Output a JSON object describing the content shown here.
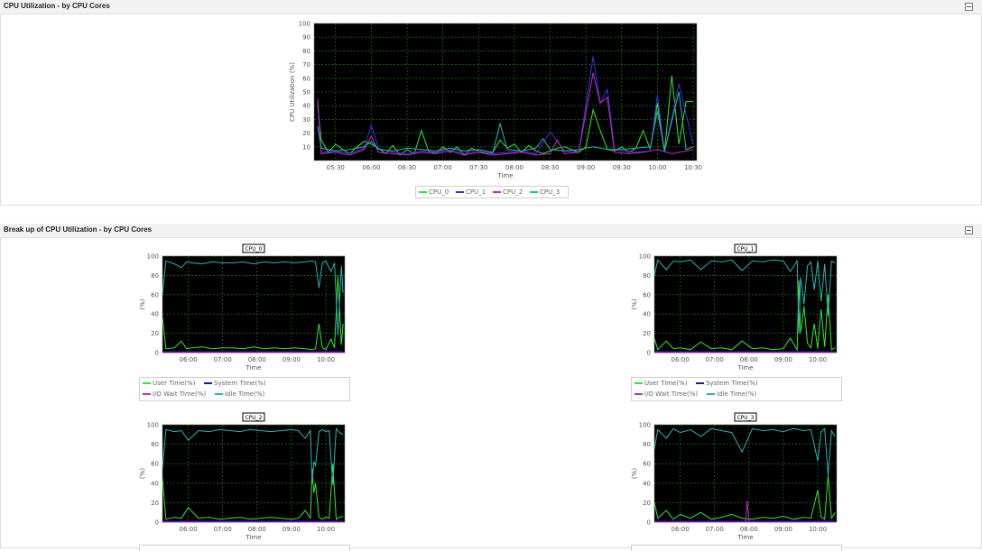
{
  "panels": {
    "top": {
      "title": "CPU Utilization - by CPU Cores"
    },
    "bottom": {
      "title": "Break up of CPU Utilization - by CPU Cores"
    }
  },
  "colors": {
    "CPU_0": "#33e633",
    "CPU_1": "#3b2fd8",
    "CPU_2": "#c02cc0",
    "CPU_3": "#2ab5b5",
    "User Time(%)": "#33e633",
    "System Time(%)": "#1a1aa0",
    "I/O Wait Time(%)": "#c02cc0",
    "Idle Time(%)": "#2ab5b5",
    "plot_bg": "#000000",
    "grid": "#1f8a1f"
  },
  "chart_data": [
    {
      "type": "line",
      "xlabel": "Time",
      "ylabel": "CPU Utilization (%)",
      "ylim": [
        0,
        100
      ],
      "yticks": [
        "100",
        "90",
        "80",
        "70",
        "60",
        "50",
        "40",
        "30",
        "20",
        "10"
      ],
      "xticks": [
        "05:30",
        "06:00",
        "06:30",
        "07:00",
        "07:30",
        "08:00",
        "08:30",
        "09:00",
        "09:30",
        "10:00",
        "10:30"
      ],
      "xrange_hours": [
        5.2,
        10.55
      ],
      "grid": true,
      "legend_position": "bottom",
      "series": [
        {
          "name": "CPU_0",
          "color": "#33e633",
          "x": [
            5.25,
            5.3,
            5.4,
            5.5,
            5.6,
            5.7,
            5.8,
            5.9,
            6.0,
            6.1,
            6.2,
            6.3,
            6.4,
            6.5,
            6.6,
            6.7,
            6.8,
            6.9,
            7.0,
            7.1,
            7.2,
            7.3,
            7.4,
            7.5,
            7.6,
            7.7,
            7.8,
            7.9,
            8.0,
            8.1,
            8.2,
            8.3,
            8.4,
            8.5,
            8.6,
            8.7,
            8.8,
            8.9,
            9.0,
            9.1,
            9.2,
            9.3,
            9.4,
            9.5,
            9.6,
            9.7,
            9.8,
            9.9,
            10.0,
            10.1,
            10.2,
            10.3,
            10.4,
            10.5
          ],
          "values": [
            40,
            15,
            6,
            12,
            8,
            5,
            10,
            14,
            12,
            9,
            5,
            11,
            4,
            8,
            5,
            22,
            7,
            5,
            10,
            6,
            10,
            4,
            9,
            7,
            5,
            6,
            15,
            9,
            12,
            6,
            11,
            7,
            5,
            7,
            9,
            10,
            8,
            6,
            10,
            37,
            22,
            8,
            7,
            10,
            6,
            9,
            22,
            8,
            42,
            6,
            62,
            12,
            43,
            43
          ]
        },
        {
          "name": "CPU_1",
          "color": "#3b2fd8",
          "x": [
            5.25,
            5.3,
            5.5,
            5.7,
            5.9,
            6.0,
            6.1,
            6.3,
            6.5,
            6.7,
            6.9,
            7.1,
            7.3,
            7.5,
            7.7,
            7.9,
            8.1,
            8.3,
            8.5,
            8.7,
            8.9,
            9.1,
            9.2,
            9.3,
            9.4,
            9.5,
            9.7,
            9.9,
            10.0,
            10.1,
            10.3,
            10.5
          ],
          "values": [
            44,
            6,
            7,
            5,
            9,
            26,
            9,
            6,
            5,
            7,
            6,
            8,
            5,
            7,
            5,
            6,
            7,
            5,
            21,
            7,
            6,
            76,
            42,
            52,
            8,
            7,
            6,
            7,
            48,
            6,
            56,
            12
          ]
        },
        {
          "name": "CPU_2",
          "color": "#c02cc0",
          "x": [
            5.25,
            5.3,
            5.5,
            5.7,
            5.9,
            6.0,
            6.1,
            6.3,
            6.5,
            6.7,
            6.9,
            7.1,
            7.3,
            7.5,
            7.7,
            7.9,
            8.1,
            8.3,
            8.5,
            8.6,
            8.7,
            8.9,
            9.1,
            9.2,
            9.3,
            9.4,
            9.6,
            9.8,
            10.0,
            10.2,
            10.4,
            10.5
          ],
          "values": [
            45,
            5,
            6,
            4,
            8,
            18,
            6,
            5,
            4,
            6,
            5,
            7,
            4,
            6,
            4,
            5,
            6,
            4,
            5,
            15,
            5,
            6,
            64,
            42,
            46,
            6,
            5,
            6,
            8,
            5,
            7,
            8
          ]
        },
        {
          "name": "CPU_3",
          "color": "#2ab5b5",
          "x": [
            5.25,
            5.3,
            5.5,
            5.7,
            5.9,
            6.0,
            6.1,
            6.3,
            6.5,
            6.7,
            6.9,
            7.1,
            7.3,
            7.5,
            7.7,
            7.8,
            7.9,
            8.1,
            8.3,
            8.4,
            8.5,
            8.7,
            8.9,
            9.1,
            9.3,
            9.5,
            9.7,
            9.9,
            10.0,
            10.1,
            10.3,
            10.4,
            10.5
          ],
          "values": [
            25,
            9,
            7,
            8,
            10,
            14,
            8,
            7,
            9,
            8,
            7,
            9,
            7,
            8,
            6,
            27,
            8,
            7,
            9,
            16,
            8,
            7,
            8,
            10,
            8,
            8,
            9,
            10,
            36,
            7,
            50,
            8,
            10
          ]
        }
      ]
    },
    {
      "type": "line",
      "title": "CPU_0",
      "xlabel": "Time",
      "ylabel": "(%)",
      "ylim": [
        0,
        100
      ],
      "yticks": [
        "100",
        "80",
        "60",
        "40",
        "20",
        "0"
      ],
      "xticks": [
        "06:00",
        "07:00",
        "08:00",
        "09:00",
        "10:00"
      ],
      "xrange_hours": [
        5.25,
        10.55
      ],
      "legend_position": "bottom",
      "series": [
        {
          "name": "User Time(%)",
          "color": "#33e633",
          "x": [
            5.25,
            5.35,
            5.6,
            5.8,
            5.95,
            6.1,
            6.4,
            6.7,
            7.0,
            7.3,
            7.6,
            7.9,
            8.2,
            8.5,
            8.8,
            9.1,
            9.4,
            9.6,
            9.7,
            9.8,
            9.9,
            10.0,
            10.15,
            10.25,
            10.35,
            10.45,
            10.5
          ],
          "values": [
            37,
            4,
            5,
            12,
            4,
            5,
            6,
            4,
            5,
            5,
            4,
            6,
            4,
            5,
            4,
            5,
            4,
            3,
            4,
            30,
            5,
            3,
            14,
            5,
            80,
            8,
            30
          ]
        },
        {
          "name": "System Time(%)",
          "color": "#1a1aa0",
          "x": [
            5.25,
            6.0,
            7.0,
            8.0,
            9.0,
            10.0,
            10.5
          ],
          "values": [
            1,
            1,
            1,
            1,
            1,
            1,
            1
          ]
        },
        {
          "name": "I/O Wait Time(%)",
          "color": "#c02cc0",
          "x": [
            5.25,
            6.0,
            7.0,
            8.0,
            9.0,
            10.0,
            10.5
          ],
          "values": [
            0,
            0,
            0,
            0,
            0,
            0,
            0
          ]
        },
        {
          "name": "Idle Time(%)",
          "color": "#2ab5b5",
          "x": [
            5.25,
            5.35,
            5.6,
            5.8,
            5.95,
            6.1,
            6.4,
            6.7,
            7.0,
            7.3,
            7.6,
            7.9,
            8.2,
            8.5,
            8.8,
            9.1,
            9.4,
            9.6,
            9.7,
            9.8,
            9.9,
            10.0,
            10.15,
            10.25,
            10.35,
            10.45,
            10.5
          ],
          "values": [
            60,
            95,
            92,
            88,
            94,
            93,
            92,
            94,
            93,
            93,
            94,
            92,
            94,
            93,
            94,
            93,
            94,
            95,
            94,
            67,
            93,
            95,
            84,
            93,
            18,
            90,
            62
          ]
        }
      ]
    },
    {
      "type": "line",
      "title": "CPU_1",
      "xlabel": "Time",
      "ylabel": "(%)",
      "ylim": [
        0,
        100
      ],
      "yticks": [
        "100",
        "80",
        "60",
        "40",
        "20",
        "0"
      ],
      "xticks": [
        "06:00",
        "07:00",
        "08:00",
        "09:00",
        "10:00"
      ],
      "xrange_hours": [
        5.25,
        10.55
      ],
      "legend_position": "bottom",
      "series": [
        {
          "name": "User Time(%)",
          "color": "#33e633",
          "x": [
            5.25,
            5.35,
            5.6,
            5.8,
            6.0,
            6.3,
            6.6,
            6.9,
            7.2,
            7.5,
            7.8,
            8.1,
            8.4,
            8.7,
            9.0,
            9.2,
            9.4,
            9.45,
            9.5,
            9.6,
            9.7,
            9.8,
            9.9,
            10.0,
            10.1,
            10.2,
            10.3,
            10.4,
            10.5
          ],
          "values": [
            15,
            3,
            12,
            4,
            5,
            3,
            11,
            4,
            5,
            3,
            12,
            4,
            5,
            3,
            4,
            15,
            3,
            75,
            20,
            48,
            10,
            5,
            30,
            4,
            45,
            6,
            60,
            3,
            5
          ]
        },
        {
          "name": "System Time(%)",
          "color": "#1a1aa0",
          "x": [
            5.25,
            6.0,
            7.0,
            8.0,
            9.0,
            10.0,
            10.5
          ],
          "values": [
            1,
            1,
            1,
            1,
            1,
            1,
            1
          ]
        },
        {
          "name": "I/O Wait Time(%)",
          "color": "#c02cc0",
          "x": [
            5.25,
            6.0,
            7.0,
            8.0,
            9.0,
            10.0,
            10.5
          ],
          "values": [
            0,
            0,
            0,
            0,
            0,
            0,
            0
          ]
        },
        {
          "name": "Idle Time(%)",
          "color": "#2ab5b5",
          "x": [
            5.25,
            5.35,
            5.6,
            5.8,
            6.0,
            6.3,
            6.6,
            6.9,
            7.2,
            7.5,
            7.8,
            8.1,
            8.4,
            8.7,
            9.0,
            9.2,
            9.4,
            9.45,
            9.5,
            9.6,
            9.7,
            9.8,
            9.9,
            10.0,
            10.1,
            10.2,
            10.3,
            10.4,
            10.5
          ],
          "values": [
            80,
            96,
            86,
            95,
            94,
            96,
            86,
            95,
            94,
            96,
            85,
            95,
            94,
            96,
            95,
            84,
            95,
            20,
            78,
            50,
            90,
            94,
            65,
            95,
            53,
            92,
            38,
            95,
            93
          ]
        }
      ]
    },
    {
      "type": "line",
      "title": "CPU_2",
      "xlabel": "Time",
      "ylabel": "(%)",
      "ylim": [
        0,
        100
      ],
      "yticks": [
        "100",
        "80",
        "60",
        "40",
        "20",
        "0"
      ],
      "xticks": [
        "06:00",
        "07:00",
        "08:00",
        "09:00",
        "10:00"
      ],
      "xrange_hours": [
        5.25,
        10.55
      ],
      "legend_position": "bottom",
      "series": [
        {
          "name": "User Time(%)",
          "color": "#33e633",
          "x": [
            5.25,
            5.35,
            5.6,
            5.8,
            6.0,
            6.3,
            6.6,
            6.9,
            7.2,
            7.5,
            7.8,
            8.1,
            8.4,
            8.7,
            9.0,
            9.2,
            9.4,
            9.55,
            9.6,
            9.65,
            9.7,
            9.8,
            9.9,
            10.0,
            10.1,
            10.2,
            10.3,
            10.4,
            10.5
          ],
          "values": [
            45,
            3,
            5,
            4,
            15,
            4,
            5,
            3,
            4,
            5,
            3,
            4,
            5,
            4,
            3,
            4,
            12,
            4,
            55,
            30,
            40,
            5,
            3,
            5,
            4,
            60,
            3,
            5,
            6
          ]
        },
        {
          "name": "System Time(%)",
          "color": "#1a1aa0",
          "x": [
            5.25,
            6.0,
            7.0,
            8.0,
            9.0,
            10.0,
            10.5
          ],
          "values": [
            1,
            1,
            1,
            1,
            1,
            1,
            1
          ]
        },
        {
          "name": "I/O Wait Time(%)",
          "color": "#c02cc0",
          "x": [
            5.25,
            6.0,
            7.0,
            8.0,
            9.0,
            10.0,
            10.5
          ],
          "values": [
            0,
            0,
            0,
            0,
            0,
            0,
            0
          ]
        },
        {
          "name": "Idle Time(%)",
          "color": "#2ab5b5",
          "x": [
            5.25,
            5.35,
            5.6,
            5.8,
            6.0,
            6.3,
            6.6,
            6.9,
            7.2,
            7.5,
            7.8,
            8.1,
            8.4,
            8.7,
            9.0,
            9.2,
            9.4,
            9.55,
            9.6,
            9.65,
            9.7,
            9.8,
            9.9,
            10.0,
            10.1,
            10.2,
            10.3,
            10.4,
            10.5
          ],
          "values": [
            55,
            95,
            93,
            94,
            84,
            94,
            93,
            95,
            94,
            93,
            95,
            94,
            93,
            94,
            95,
            94,
            86,
            94,
            40,
            62,
            58,
            93,
            95,
            93,
            94,
            38,
            96,
            92,
            90
          ]
        }
      ]
    },
    {
      "type": "line",
      "title": "CPU_3",
      "xlabel": "Time",
      "ylabel": "(%)",
      "ylim": [
        0,
        100
      ],
      "yticks": [
        "100",
        "80",
        "60",
        "40",
        "20",
        "0"
      ],
      "xticks": [
        "06:00",
        "07:00",
        "08:00",
        "09:00",
        "10:00"
      ],
      "xrange_hours": [
        5.25,
        10.55
      ],
      "legend_position": "bottom",
      "series": [
        {
          "name": "User Time(%)",
          "color": "#33e633",
          "x": [
            5.25,
            5.35,
            5.6,
            5.8,
            6.0,
            6.3,
            6.6,
            6.9,
            7.2,
            7.5,
            7.8,
            8.1,
            8.4,
            8.7,
            9.0,
            9.3,
            9.6,
            9.8,
            10.0,
            10.1,
            10.2,
            10.3,
            10.4,
            10.5
          ],
          "values": [
            20,
            4,
            12,
            3,
            8,
            4,
            10,
            3,
            5,
            8,
            4,
            3,
            5,
            4,
            6,
            3,
            5,
            4,
            33,
            5,
            3,
            48,
            4,
            10
          ]
        },
        {
          "name": "System Time(%)",
          "color": "#1a1aa0",
          "x": [
            5.25,
            6.0,
            7.0,
            8.0,
            9.0,
            10.0,
            10.5
          ],
          "values": [
            1,
            1,
            1,
            1,
            1,
            1,
            1
          ]
        },
        {
          "name": "I/O Wait Time(%)",
          "color": "#c02cc0",
          "x": [
            5.25,
            7.0,
            7.9,
            7.95,
            8.0,
            9.0,
            10.5
          ],
          "values": [
            0,
            0,
            0,
            22,
            0,
            0,
            0
          ]
        },
        {
          "name": "Idle Time(%)",
          "color": "#2ab5b5",
          "x": [
            5.25,
            5.35,
            5.6,
            5.8,
            6.0,
            6.3,
            6.6,
            6.9,
            7.2,
            7.5,
            7.8,
            8.1,
            8.4,
            8.7,
            9.0,
            9.3,
            9.6,
            9.8,
            10.0,
            10.1,
            10.2,
            10.3,
            10.4,
            10.5
          ],
          "values": [
            75,
            95,
            86,
            96,
            92,
            95,
            88,
            96,
            94,
            92,
            72,
            96,
            94,
            95,
            93,
            96,
            94,
            95,
            63,
            93,
            96,
            48,
            94,
            88
          ]
        }
      ]
    }
  ]
}
